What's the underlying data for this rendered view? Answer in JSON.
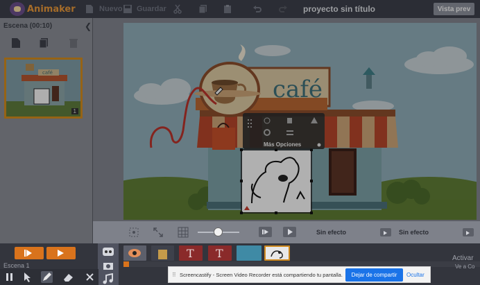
{
  "app": {
    "logo_text": "Animaker"
  },
  "toolbar": {
    "new_label": "Nuevo",
    "save_label": "Guardar",
    "project_title": "proyecto sin título",
    "preview_label": "Vista prev"
  },
  "scenes": {
    "header": "Escena  (00:10)",
    "thumbnail_badge": "1",
    "thumbnail_label": "café"
  },
  "stage": {
    "sign_text": "café",
    "context_menu_label": "Más Opciones"
  },
  "controls": {
    "effect_in": "Sin efecto",
    "effect_out": "Sin efecto"
  },
  "timeline": {
    "scene_label": "Escena 1",
    "chip_text_1": "T",
    "chip_text_2": "T"
  },
  "notification": {
    "message": "Screencastify - Screen Video Recorder está compartiendo tu pantalla.",
    "share_label": "Dejar de compartir",
    "hide_label": "Ocultar"
  },
  "watermark": {
    "line1": "Activar",
    "line2": "Ve a Co"
  },
  "colors": {
    "accent_orange": "#d9731c",
    "dim_overlay": "#3c3f4a",
    "share_blue": "#1a73e8",
    "thumb_border": "#d08a1e"
  }
}
